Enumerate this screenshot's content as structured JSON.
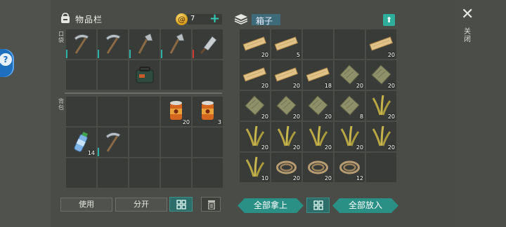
{
  "inventory": {
    "title": "物品栏",
    "coins": "7",
    "pocket_label": "口袋",
    "backpack_label": "背包",
    "pocket_slots": [
      {
        "item": "pickaxe-icon",
        "count": "",
        "durability": "teal"
      },
      {
        "item": "pickaxe-icon",
        "count": "",
        "durability": "teal"
      },
      {
        "item": "hatchet-icon",
        "count": "",
        "durability": "teal"
      },
      {
        "item": "hatchet-icon",
        "count": "",
        "durability": "teal"
      },
      {
        "item": "cleaver-icon",
        "count": "",
        "durability": "red"
      },
      {
        "item": "",
        "count": "",
        "durability": ""
      },
      {
        "item": "",
        "count": "",
        "durability": ""
      },
      {
        "item": "bag-item-icon",
        "count": "",
        "durability": ""
      },
      {
        "item": "",
        "count": "",
        "durability": ""
      },
      {
        "item": "",
        "count": "",
        "durability": ""
      }
    ],
    "backpack_slots": [
      {
        "item": "",
        "count": ""
      },
      {
        "item": "",
        "count": ""
      },
      {
        "item": "",
        "count": ""
      },
      {
        "item": "canned-food-icon",
        "count": "20"
      },
      {
        "item": "canned-food-icon",
        "count": "3"
      },
      {
        "item": "water-bottle-icon",
        "count": "14"
      },
      {
        "item": "pickaxe-icon",
        "count": "",
        "durability": "teal"
      },
      {
        "item": "",
        "count": ""
      },
      {
        "item": "",
        "count": ""
      },
      {
        "item": "",
        "count": ""
      },
      {
        "item": "",
        "count": ""
      },
      {
        "item": "",
        "count": ""
      },
      {
        "item": "",
        "count": ""
      },
      {
        "item": "",
        "count": ""
      },
      {
        "item": "",
        "count": ""
      }
    ],
    "buttons": {
      "use": "使用",
      "split": "分开"
    }
  },
  "box": {
    "title": "箱子",
    "close_label": "关闭",
    "slots": [
      {
        "item": "wood-plank-icon",
        "count": "20"
      },
      {
        "item": "wood-plank-icon",
        "count": "5"
      },
      {
        "item": "",
        "count": ""
      },
      {
        "item": "",
        "count": ""
      },
      {
        "item": "wood-plank-icon",
        "count": "20"
      },
      {
        "item": "wood-plank-icon",
        "count": "20"
      },
      {
        "item": "wood-plank-icon",
        "count": "20"
      },
      {
        "item": "wood-plank-icon",
        "count": "18"
      },
      {
        "item": "cloth-icon",
        "count": "20"
      },
      {
        "item": "cloth-icon",
        "count": "20"
      },
      {
        "item": "cloth-icon",
        "count": "20"
      },
      {
        "item": "cloth-icon",
        "count": "20"
      },
      {
        "item": "cloth-icon",
        "count": "20"
      },
      {
        "item": "cloth-icon",
        "count": "8"
      },
      {
        "item": "plant-fiber-icon",
        "count": "20"
      },
      {
        "item": "plant-fiber-icon",
        "count": "20"
      },
      {
        "item": "plant-fiber-icon",
        "count": "20"
      },
      {
        "item": "plant-fiber-icon",
        "count": "20"
      },
      {
        "item": "plant-fiber-icon",
        "count": "20"
      },
      {
        "item": "plant-fiber-icon",
        "count": "20"
      },
      {
        "item": "plant-fiber-icon",
        "count": "10"
      },
      {
        "item": "rope-icon",
        "count": "20"
      },
      {
        "item": "rope-icon",
        "count": "20"
      },
      {
        "item": "rope-icon",
        "count": "12"
      },
      {
        "item": "",
        "count": ""
      }
    ],
    "buttons": {
      "take_all": "全部拿上",
      "put_all": "全部放入"
    }
  },
  "colors": {
    "accent": "#2a8f84",
    "durability": "#2bb3a7",
    "durability_low": "#d13a2c"
  }
}
